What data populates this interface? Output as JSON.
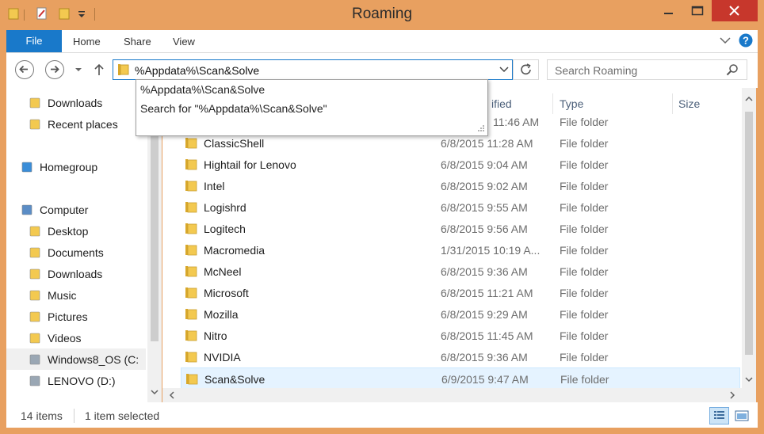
{
  "window": {
    "title": "Roaming"
  },
  "ribbon": {
    "tabs": [
      "File",
      "Home",
      "Share",
      "View"
    ]
  },
  "address": {
    "value": "%Appdata%\\Scan&Solve"
  },
  "search": {
    "placeholder": "Search Roaming"
  },
  "autocomplete": {
    "items": [
      "%Appdata%\\Scan&Solve",
      "Search for \"%Appdata%\\Scan&Solve\""
    ]
  },
  "nav": {
    "items": [
      {
        "label": "Downloads",
        "icon": "downloads-icon"
      },
      {
        "label": "Recent places",
        "icon": "recent-places-icon"
      },
      {
        "label": "Homegroup",
        "icon": "homegroup-icon"
      },
      {
        "label": "Computer",
        "icon": "computer-icon"
      },
      {
        "label": "Desktop",
        "icon": "desktop-icon"
      },
      {
        "label": "Documents",
        "icon": "documents-icon"
      },
      {
        "label": "Downloads",
        "icon": "downloads-icon"
      },
      {
        "label": "Music",
        "icon": "music-icon"
      },
      {
        "label": "Pictures",
        "icon": "pictures-icon"
      },
      {
        "label": "Videos",
        "icon": "videos-icon"
      },
      {
        "label": "Windows8_OS (C:",
        "icon": "drive-icon"
      },
      {
        "label": "LENOVO (D:)",
        "icon": "drive-icon"
      }
    ]
  },
  "columns": {
    "modified": "ified",
    "type": "Type",
    "size": "Size"
  },
  "files": [
    {
      "name": "",
      "date": "11:46 AM",
      "type": "File folder"
    },
    {
      "name": "ClassicShell",
      "date": "6/8/2015 11:28 AM",
      "type": "File folder"
    },
    {
      "name": "Hightail for Lenovo",
      "date": "6/8/2015 9:04 AM",
      "type": "File folder"
    },
    {
      "name": "Intel",
      "date": "6/8/2015 9:02 AM",
      "type": "File folder"
    },
    {
      "name": "Logishrd",
      "date": "6/8/2015 9:55 AM",
      "type": "File folder"
    },
    {
      "name": "Logitech",
      "date": "6/8/2015 9:56 AM",
      "type": "File folder"
    },
    {
      "name": "Macromedia",
      "date": "1/31/2015 10:19 A...",
      "type": "File folder"
    },
    {
      "name": "McNeel",
      "date": "6/8/2015 9:36 AM",
      "type": "File folder"
    },
    {
      "name": "Microsoft",
      "date": "6/8/2015 11:21 AM",
      "type": "File folder"
    },
    {
      "name": "Mozilla",
      "date": "6/8/2015 9:29 AM",
      "type": "File folder"
    },
    {
      "name": "Nitro",
      "date": "6/8/2015 11:45 AM",
      "type": "File folder"
    },
    {
      "name": "NVIDIA",
      "date": "6/8/2015 9:36 AM",
      "type": "File folder"
    },
    {
      "name": "Scan&Solve",
      "date": "6/9/2015 9:47 AM",
      "type": "File folder"
    }
  ],
  "status": {
    "count": "14 items",
    "selected": "1 item selected"
  },
  "colors": {
    "frame": "#e8a060",
    "accent": "#1979ca",
    "close": "#c7372c",
    "selection": "#e5f3ff"
  }
}
